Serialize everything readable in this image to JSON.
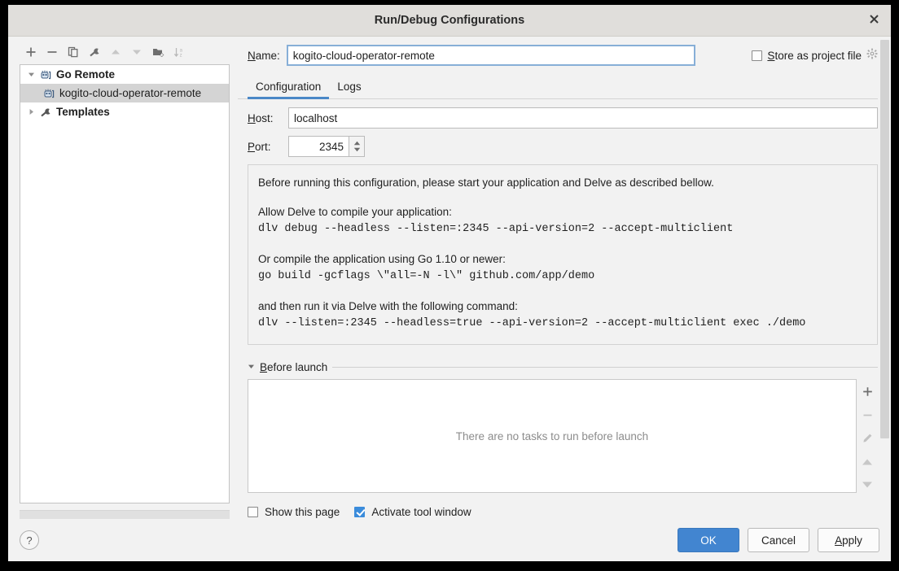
{
  "window": {
    "title": "Run/Debug Configurations",
    "close_icon": "close-icon"
  },
  "sidebar": {
    "toolbar": [
      {
        "name": "add-configuration-button",
        "icon": "plus-icon"
      },
      {
        "name": "remove-configuration-button",
        "icon": "minus-icon"
      },
      {
        "name": "copy-configuration-button",
        "icon": "copy-icon"
      },
      {
        "name": "edit-templates-button",
        "icon": "wrench-icon"
      },
      {
        "name": "move-up-button",
        "icon": "arrow-up-icon"
      },
      {
        "name": "move-down-button",
        "icon": "arrow-down-icon"
      },
      {
        "name": "create-folder-button",
        "icon": "folder-add-icon"
      },
      {
        "name": "sort-configurations-button",
        "icon": "sort-az-icon"
      }
    ],
    "tree": [
      {
        "label": "Go Remote",
        "level": 0,
        "expanded": true,
        "bold": true,
        "selected": false,
        "icon": "go-remote-icon"
      },
      {
        "label": "kogito-cloud-operator-remote",
        "level": 1,
        "expanded": null,
        "bold": false,
        "selected": true,
        "icon": "go-remote-icon"
      },
      {
        "label": "Templates",
        "level": 0,
        "expanded": false,
        "bold": true,
        "selected": false,
        "icon": "wrench-icon"
      }
    ]
  },
  "form": {
    "name_label": "Name:",
    "name_accel": "N",
    "name_value": "kogito-cloud-operator-remote",
    "store_as_project_file_label": "Store as project file",
    "store_as_project_file_accel": "S",
    "store_as_project_file_checked": false,
    "store_gear_icon": "gear-icon",
    "tabs": [
      {
        "label": "Configuration",
        "active": true
      },
      {
        "label": "Logs",
        "active": false
      }
    ],
    "host_label": "Host:",
    "host_accel": "H",
    "host_value": "localhost",
    "port_label": "Port:",
    "port_accel": "P",
    "port_value": "2345",
    "info": [
      {
        "type": "text",
        "text": "Before running this configuration, please start your application and Delve as described bellow."
      },
      {
        "type": "gap"
      },
      {
        "type": "text",
        "text": "Allow Delve to compile your application:"
      },
      {
        "type": "code",
        "text": "dlv debug --headless --listen=:2345 --api-version=2 --accept-multiclient"
      },
      {
        "type": "gap"
      },
      {
        "type": "text",
        "text": "Or compile the application using Go 1.10 or newer:"
      },
      {
        "type": "code",
        "text": "go build -gcflags \\\"all=-N -l\\\" github.com/app/demo"
      },
      {
        "type": "gap"
      },
      {
        "type": "text",
        "text": "and then run it via Delve with the following command:"
      },
      {
        "type": "code",
        "text": "dlv --listen=:2345 --headless=true --api-version=2 --accept-multiclient exec ./demo"
      }
    ],
    "before_launch": {
      "title": "Before launch",
      "accel": "B",
      "expanded": true,
      "empty_text": "There are no tasks to run before launch",
      "actions": [
        {
          "name": "add-task-button",
          "icon": "plus-icon"
        },
        {
          "name": "remove-task-button",
          "icon": "minus-icon"
        },
        {
          "name": "edit-task-button",
          "icon": "pencil-icon"
        },
        {
          "name": "move-task-up-button",
          "icon": "arrow-up-icon"
        },
        {
          "name": "move-task-down-button",
          "icon": "arrow-down-icon"
        }
      ]
    },
    "show_this_page_label": "Show this page",
    "show_this_page_checked": false,
    "activate_tool_window_label": "Activate tool window",
    "activate_tool_window_checked": true
  },
  "footer": {
    "help_label": "?",
    "ok_label": "OK",
    "cancel_label": "Cancel",
    "apply_label": "Apply",
    "apply_accel": "A"
  },
  "colors": {
    "accent": "#4285d0",
    "tab_underline": "#4a88c7",
    "focus_border": "#87afd7",
    "selection": "#d4d4d4",
    "titlebar": "#e0dedb",
    "dialog_bg": "#f2f2f2"
  }
}
